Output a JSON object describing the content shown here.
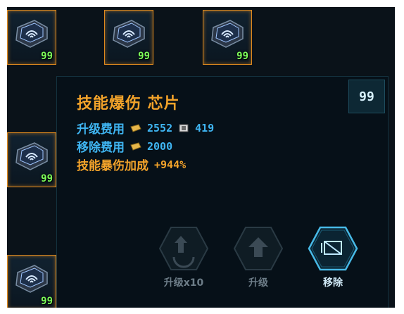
{
  "slots": [
    {
      "count": "99"
    },
    {
      "count": "99"
    },
    {
      "count": "99"
    },
    {
      "count": "99"
    },
    {
      "count": "99"
    }
  ],
  "panel": {
    "title": "技能爆伤 芯片",
    "count": "99",
    "upgrade_cost_label": "升级费用",
    "upgrade_cost_gold": "2552",
    "upgrade_cost_chip": "419",
    "remove_cost_label": "移除费用",
    "remove_cost_gold": "2000",
    "bonus_label": "技能暴伤加成",
    "bonus_value": "+944%"
  },
  "actions": {
    "upgrade_x10": "升级x10",
    "upgrade": "升级",
    "remove": "移除"
  },
  "colors": {
    "accent_orange": "#f3a32a",
    "accent_blue": "#3fb5f2",
    "count_green": "#7dff5a",
    "bg": "#0a1219"
  },
  "icons": [
    "chip-icon",
    "gold-coin-icon",
    "chip-material-icon",
    "upgrade-x10-icon",
    "upgrade-icon",
    "remove-icon"
  ]
}
